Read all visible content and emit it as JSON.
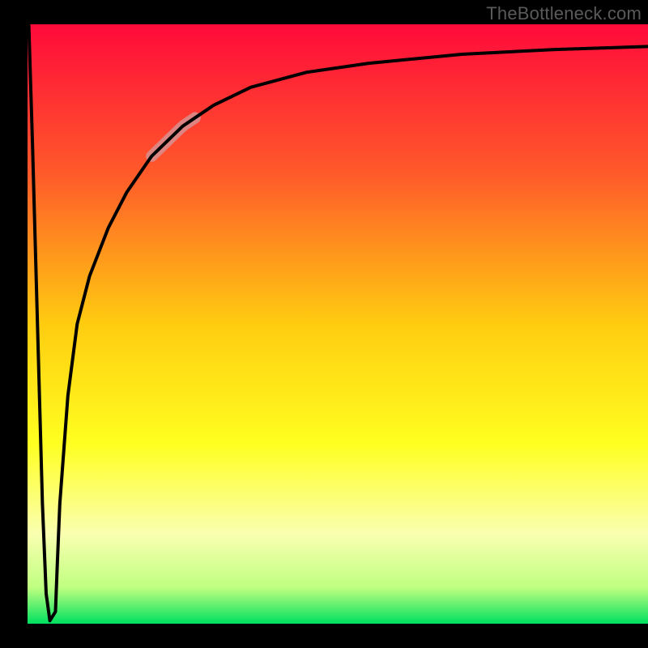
{
  "watermark": "TheBottleneck.com",
  "chart_data": {
    "type": "line",
    "title": "",
    "xlabel": "",
    "ylabel": "",
    "xlim": [
      0,
      100
    ],
    "ylim": [
      0,
      100
    ],
    "grid": false,
    "legend": false,
    "background_gradient": {
      "stops": [
        {
          "offset": 0.0,
          "color": "#ff0a3a"
        },
        {
          "offset": 0.25,
          "color": "#ff5a2a"
        },
        {
          "offset": 0.5,
          "color": "#ffcc10"
        },
        {
          "offset": 0.7,
          "color": "#ffff20"
        },
        {
          "offset": 0.85,
          "color": "#faffb0"
        },
        {
          "offset": 0.94,
          "color": "#bfff80"
        },
        {
          "offset": 1.0,
          "color": "#00e060"
        }
      ]
    },
    "series": [
      {
        "name": "bottleneck-curve",
        "color": "#000000",
        "x": [
          0.2,
          0.8,
          1.6,
          2.4,
          3.0,
          3.6,
          4.5,
          4.8,
          5.2,
          6.5,
          8.0,
          10.0,
          13.0,
          16.0,
          20.0,
          25.0,
          30.0,
          36.0,
          45.0,
          55.0,
          70.0,
          85.0,
          100.0
        ],
        "y": [
          100,
          80,
          50,
          20,
          5,
          0.5,
          2,
          10,
          20,
          38,
          50,
          58,
          66,
          72,
          78,
          83,
          86.5,
          89.5,
          92,
          93.5,
          95,
          95.8,
          96.3
        ]
      }
    ],
    "highlight_segment": {
      "series": "bottleneck-curve",
      "x_start": 20,
      "x_end": 27,
      "color": "#d98c8c",
      "width": 14
    }
  }
}
